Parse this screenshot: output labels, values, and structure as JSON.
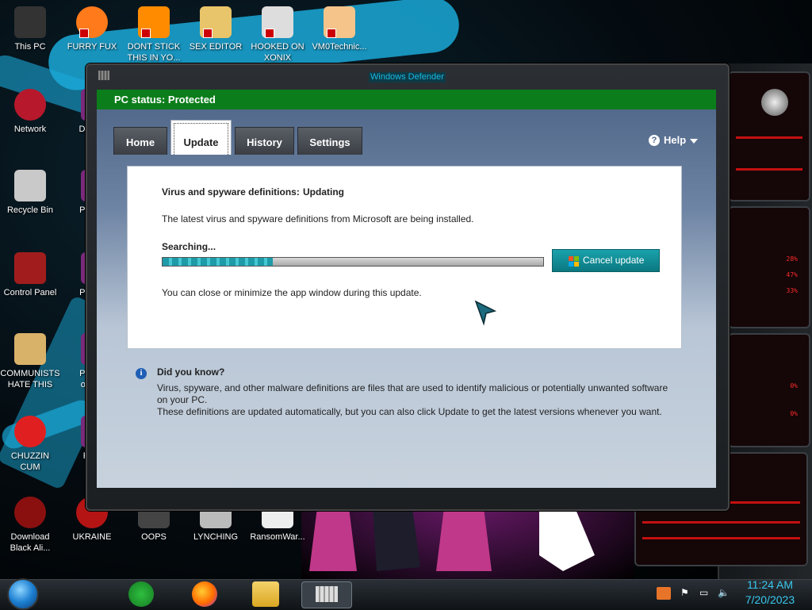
{
  "window": {
    "title": "Windows Defender",
    "status": "PC status: Protected",
    "tabs": [
      "Home",
      "Update",
      "History",
      "Settings"
    ],
    "active_tab": "Update",
    "help_label": "Help",
    "update": {
      "definitions_label": "Virus and spyware definitions:",
      "definitions_status": "Updating",
      "installing_text": "The latest virus and spyware definitions from Microsoft are being installed.",
      "progress_label": "Searching...",
      "progress_fraction": 0.29,
      "cancel_button": "Cancel update",
      "close_note": "You can close or minimize the app window during this update."
    },
    "did_you_know": {
      "title": "Did you know?",
      "line1": "Virus, spyware, and other malware definitions are files that are used to identify malicious or potentially unwanted software",
      "line2": "on your PC.",
      "line3": "These definitions are updated automatically, but you can also click Update to get the latest versions whenever you want."
    }
  },
  "desktop_icons": [
    {
      "label": "This PC",
      "icon": "computer-icon"
    },
    {
      "label": "FURRY FUX",
      "icon": "firefox-icon"
    },
    {
      "label": "DONT STICK THIS IN YO...",
      "icon": "vlc-cone-icon"
    },
    {
      "label": "SEX EDITOR",
      "icon": "hxd-editor-icon"
    },
    {
      "label": "HOOKED ON XONIX",
      "icon": "xonix-game-icon"
    },
    {
      "label": "VM0Technic...",
      "icon": "doctor-avatar-icon"
    },
    {
      "label": "Network",
      "icon": "network-globe-icon"
    },
    {
      "label": "Recycle Bin",
      "icon": "recycle-bin-icon"
    },
    {
      "label": "Control Panel",
      "icon": "control-panel-icon"
    },
    {
      "label": "COMMUNISTS HATE THIS G...",
      "icon": "money-bag-icon"
    },
    {
      "label": "CHUZZIN CUM",
      "icon": "chuzzle-icon"
    },
    {
      "label": "Download Black Ali...",
      "icon": "alien-orb-icon"
    },
    {
      "label": "UKRAINE",
      "icon": "hazard-icon"
    },
    {
      "label": "OOPS",
      "icon": "gun-icon"
    },
    {
      "label": "LYNCHING",
      "icon": "robot-flag-icon"
    },
    {
      "label": "RansomWar...",
      "icon": "skull-icon"
    },
    {
      "label": "D DU",
      "icon": "partial-icon"
    },
    {
      "label": "Pegg",
      "icon": "partial-icon"
    },
    {
      "label": "Pegg",
      "icon": "partial-icon"
    },
    {
      "label": "Pegg of W",
      "icon": "partial-icon"
    },
    {
      "label": "F Z",
      "icon": "partial-icon"
    }
  ],
  "taskbar": {
    "apps": [
      "chat-bubble-icon",
      "firefox-icon",
      "file-explorer-icon",
      "defender-castle-icon"
    ],
    "clock_time": "11:24 AM",
    "clock_date": "7/20/2023"
  }
}
